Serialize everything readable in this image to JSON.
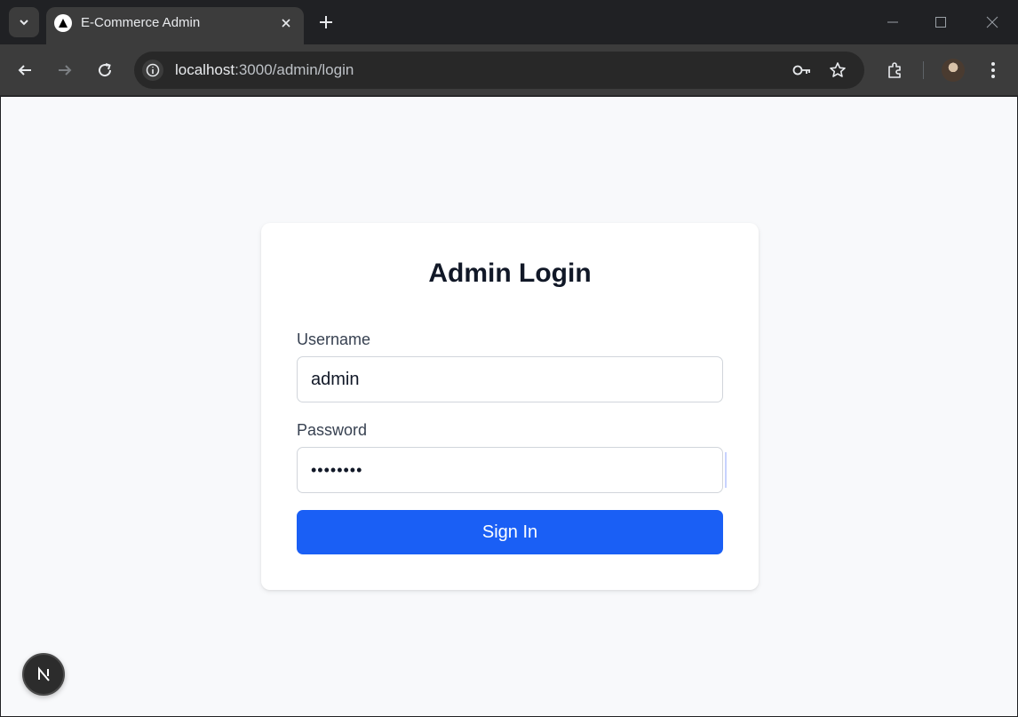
{
  "browser": {
    "tab_title": "E-Commerce Admin",
    "url_host": "localhost",
    "url_path": ":3000/admin/login"
  },
  "login": {
    "title": "Admin Login",
    "username_label": "Username",
    "username_value": "admin",
    "password_label": "Password",
    "password_masked": "••••••••",
    "submit_label": "Sign In"
  },
  "colors": {
    "accent": "#1a5ff5",
    "page_bg": "#f8f9fb",
    "chrome_bg": "#202124"
  }
}
